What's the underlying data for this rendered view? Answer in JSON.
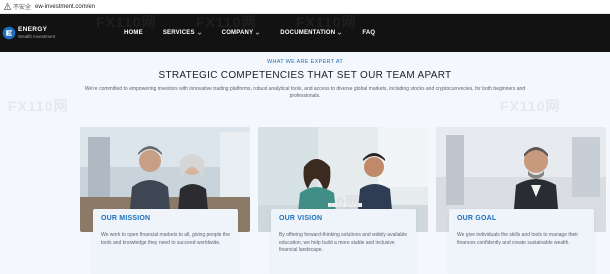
{
  "browser": {
    "security_label": "不安全",
    "url": "ew-investment.com/en"
  },
  "nav": {
    "brand_name": "ENERGY",
    "brand_sub": "Wealth Investment",
    "items": [
      {
        "label": "HOME",
        "has_dropdown": false
      },
      {
        "label": "SERVICES",
        "has_dropdown": true
      },
      {
        "label": "COMPANY",
        "has_dropdown": true
      },
      {
        "label": "DOCUMENTATION",
        "has_dropdown": true
      },
      {
        "label": "FAQ",
        "has_dropdown": false
      }
    ]
  },
  "hero": {
    "eyebrow": "WHAT WE ARE EXPERT AT",
    "headline": "STRATEGIC COMPETENCIES THAT SET OUR TEAM APART",
    "lede": "We're committed to empowering investors with innovative trading platforms, robust analytical tools, and access to diverse global markets, including stocks and cryptocurrencies, for both beginners and professionals."
  },
  "cards": [
    {
      "title": "OUR MISSION",
      "text": "We work to open financial markets to all, giving people the tools and knowledge they need to succeed worldwide."
    },
    {
      "title": "OUR VISION",
      "text": "By offering forward-thinking solutions and widely available education, we help build a more stable and inclusive financial landscape."
    },
    {
      "title": "OUR GOAL",
      "text": "We give individuals the skills and tools to manage their finances confidently and create sustainable wealth."
    }
  ],
  "watermark_text": "FX110网",
  "colors": {
    "nav_bg": "#121212",
    "accent": "#1d6fbd",
    "page_bg": "#f4f7fb",
    "card_bg": "#eef4fa"
  }
}
